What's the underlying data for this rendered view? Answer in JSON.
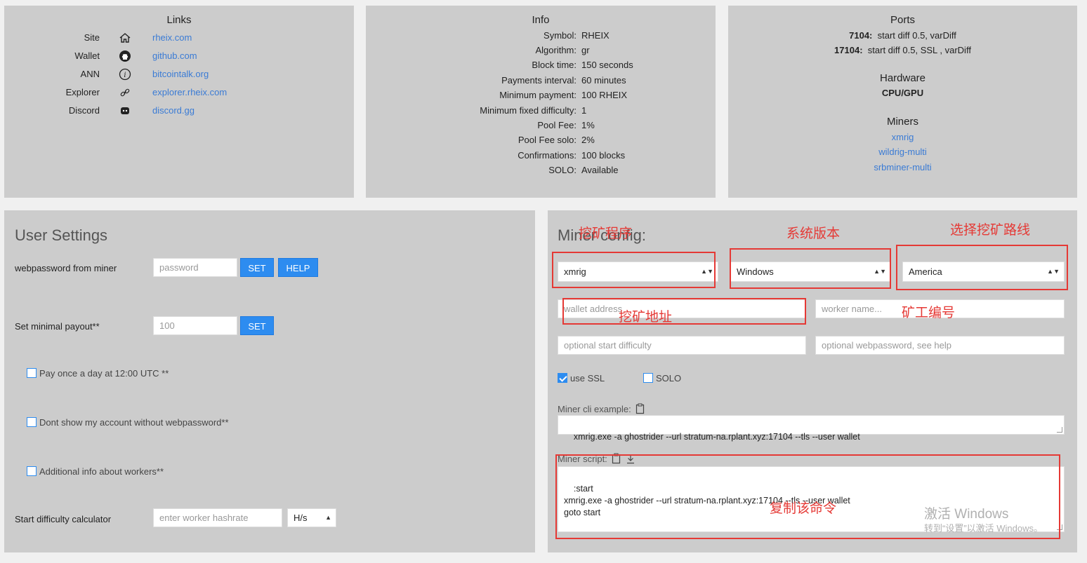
{
  "links": {
    "title": "Links",
    "items": [
      {
        "label": "Site",
        "icon": "home-icon",
        "link": "rheix.com"
      },
      {
        "label": "Wallet",
        "icon": "github-icon",
        "link": "github.com"
      },
      {
        "label": "ANN",
        "icon": "info-icon",
        "link": "bitcointalk.org"
      },
      {
        "label": "Explorer",
        "icon": "link-icon",
        "link": "explorer.rheix.com"
      },
      {
        "label": "Discord",
        "icon": "discord-icon",
        "link": "discord.gg"
      }
    ]
  },
  "info": {
    "title": "Info",
    "rows": [
      {
        "k": "Symbol:",
        "v": "RHEIX"
      },
      {
        "k": "Algorithm:",
        "v": "gr"
      },
      {
        "k": "Block time:",
        "v": "150 seconds"
      },
      {
        "k": "Payments interval:",
        "v": "60 minutes"
      },
      {
        "k": "Minimum payment:",
        "v": "100 RHEIX"
      },
      {
        "k": "Minimum fixed difficulty:",
        "v": "1"
      },
      {
        "k": "Pool Fee:",
        "v": "1%"
      },
      {
        "k": "Pool Fee solo:",
        "v": "2%"
      },
      {
        "k": "Confirmations:",
        "v": "100 blocks"
      },
      {
        "k": "SOLO:",
        "v": "Available"
      }
    ]
  },
  "ports": {
    "title": "Ports",
    "port1": {
      "num": "7104",
      "desc": "start diff 0.5, varDiff"
    },
    "port2": {
      "num": "17104",
      "desc": "start diff 0.5, SSL , varDiff"
    },
    "colon": ":",
    "hardware_title": "Hardware",
    "hardware_value": "CPU/GPU",
    "miners_title": "Miners",
    "miners": [
      "xmrig",
      "wildrig-multi",
      "srbminer-multi"
    ]
  },
  "user_settings": {
    "title": "User Settings",
    "webpassword_label": "webpassword from miner",
    "webpassword_placeholder": "password",
    "set_label": "SET",
    "help_label": "HELP",
    "payout_label": "Set minimal payout**",
    "payout_value": "100",
    "checkbox_pay_once": "Pay once a day at 12:00 UTC **",
    "checkbox_dont_show": "Dont show my account without webpassword**",
    "checkbox_additional": "Additional info about workers**",
    "calc_label": "Start difficulty calculator",
    "calc_placeholder": "enter worker hashrate",
    "calc_unit": "H/s"
  },
  "miner_config": {
    "title": "Miner config:",
    "miner_select": "xmrig",
    "os_select": "Windows",
    "region_select": "America",
    "wallet_placeholder": "wallet address",
    "worker_placeholder": "worker name...",
    "difficulty_placeholder": "optional start difficulty",
    "webpassword_placeholder": "optional webpassword, see help",
    "ssl_label": "use SSL",
    "ssl_checked": true,
    "solo_label": "SOLO",
    "solo_checked": false,
    "cli_label": "Miner cli example:",
    "cli_value": "xmrig.exe -a ghostrider --url stratum-na.rplant.xyz:17104 --tls --user wallet",
    "script_label": "Miner script:",
    "script_value": ":start\nxmrig.exe -a ghostrider --url stratum-na.rplant.xyz:17104 --tls --user wallet\ngoto start"
  },
  "annotations": {
    "miner_program": "挖矿程序",
    "os_version": "系统版本",
    "route": "选择挖矿路线",
    "address": "挖矿地址",
    "worker_no": "矿工编号",
    "copy_cmd": "复制该命令",
    "color": "#e53935"
  },
  "watermark": {
    "line1": "激活 Windows",
    "line2": "转到“设置”以激活 Windows。"
  }
}
